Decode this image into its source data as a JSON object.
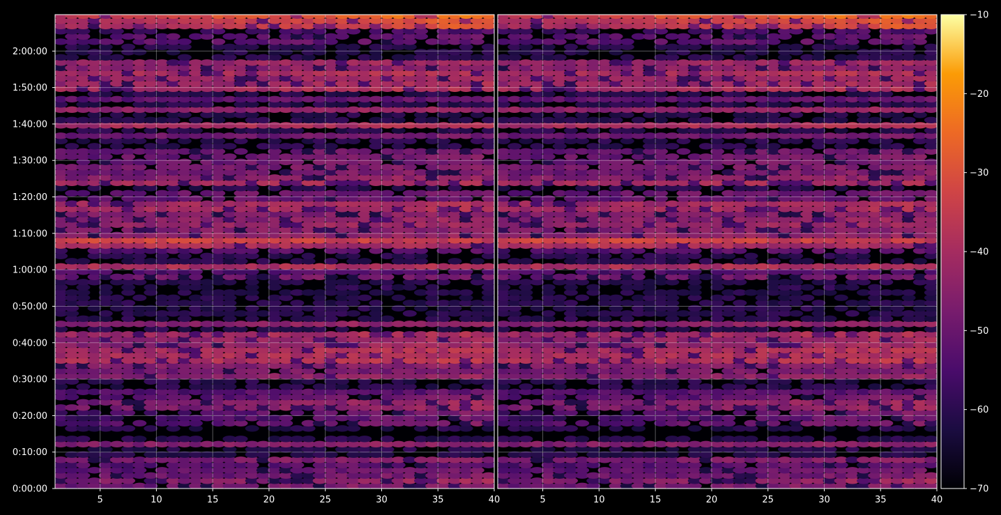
{
  "chart_data": {
    "type": "heatmap",
    "title": "",
    "xlabel": "",
    "ylabel": "",
    "grid": true,
    "panels": [
      {
        "x_ticks": [
          5,
          10,
          15,
          20,
          25,
          30,
          35,
          40
        ],
        "xlim": [
          1,
          40
        ],
        "y_ticks_seconds": [
          0,
          600,
          1200,
          1800,
          2400,
          3000,
          3600,
          4200,
          4800,
          5400,
          6000,
          6600,
          7200
        ],
        "y_tick_labels": [
          "0:00:00",
          "0:10:00",
          "0:20:00",
          "0:30:00",
          "0:40:00",
          "0:50:00",
          "1:00:00",
          "1:10:00",
          "1:20:00",
          "1:30:00",
          "1:40:00",
          "1:50:00",
          "2:00:00"
        ],
        "ylim_seconds": [
          0,
          7800
        ]
      },
      {
        "x_ticks": [
          5,
          10,
          15,
          20,
          25,
          30,
          35,
          40
        ],
        "xlim": [
          1,
          40
        ],
        "ylim_seconds": [
          0,
          7800
        ]
      }
    ],
    "bands": [
      {
        "t0": 0,
        "t1": 180,
        "level": -47,
        "trend": 7,
        "stripe": 0.85
      },
      {
        "t0": 180,
        "t1": 480,
        "level": -50,
        "trend": 4,
        "stripe": 0.9
      },
      {
        "t0": 480,
        "t1": 530,
        "level": -44,
        "trend": 2,
        "stripe": 1
      },
      {
        "t0": 710,
        "t1": 790,
        "level": -45,
        "trend": 3,
        "stripe": 1
      },
      {
        "t0": 880,
        "t1": 950,
        "level": -68,
        "trend": 0,
        "stripe": 0.3
      },
      {
        "t0": 1000,
        "t1": 1260,
        "level": -57,
        "trend": 9,
        "stripe": 0.7
      },
      {
        "t0": 1260,
        "t1": 1560,
        "level": -53,
        "trend": 8,
        "stripe": 0.8
      },
      {
        "t0": 1580,
        "t1": 1620,
        "level": -54,
        "trend": 4,
        "stripe": 1
      },
      {
        "t0": 1840,
        "t1": 2040,
        "level": -47,
        "trend": 3,
        "stripe": 0.9
      },
      {
        "t0": 2040,
        "t1": 2200,
        "level": -44,
        "trend": 4,
        "stripe": 0.9
      },
      {
        "t0": 2260,
        "t1": 2580,
        "level": -42,
        "trend": 5,
        "stripe": 0.85
      },
      {
        "t0": 2690,
        "t1": 2780,
        "level": -49,
        "trend": 4,
        "stripe": 1
      },
      {
        "t0": 3000,
        "t1": 3050,
        "level": -68,
        "trend": 0,
        "stripe": 0.3
      },
      {
        "t0": 3300,
        "t1": 3380,
        "level": -59,
        "trend": 0,
        "stripe": 0.7
      },
      {
        "t0": 3420,
        "t1": 3720,
        "level": -52,
        "trend": 2,
        "stripe": 0.8
      },
      {
        "t0": 3600,
        "t1": 3660,
        "level": -43,
        "trend": 0,
        "stripe": 1
      },
      {
        "t0": 3840,
        "t1": 3960,
        "level": -56,
        "trend": 4,
        "stripe": 0.7
      },
      {
        "t0": 3960,
        "t1": 4110,
        "level": -42,
        "trend": -2,
        "stripe": 0.9
      },
      {
        "t0": 4080,
        "t1": 4160,
        "level": -29,
        "trend": -3,
        "stripe": 1
      },
      {
        "t0": 4160,
        "t1": 4740,
        "level": -45,
        "trend": 4,
        "stripe": 0.85
      },
      {
        "t0": 4760,
        "t1": 4900,
        "level": -53,
        "trend": 5,
        "stripe": 0.8
      },
      {
        "t0": 5000,
        "t1": 5300,
        "level": -46,
        "trend": 4,
        "stripe": 0.85
      },
      {
        "t0": 5300,
        "t1": 5600,
        "level": -50,
        "trend": 4,
        "stripe": 0.8
      },
      {
        "t0": 5660,
        "t1": 5720,
        "level": -43,
        "trend": 0,
        "stripe": 1
      },
      {
        "t0": 5800,
        "t1": 5880,
        "level": -53,
        "trend": 3,
        "stripe": 1
      },
      {
        "t0": 5920,
        "t1": 6000,
        "level": -42,
        "trend": 4,
        "stripe": 1
      },
      {
        "t0": 6200,
        "t1": 6250,
        "level": -47,
        "trend": 2,
        "stripe": 1
      },
      {
        "t0": 6400,
        "t1": 6450,
        "level": -52,
        "trend": 2,
        "stripe": 1
      },
      {
        "t0": 6500,
        "t1": 7050,
        "level": -44,
        "trend": 3,
        "stripe": 0.85
      },
      {
        "t0": 6600,
        "t1": 6660,
        "level": -54,
        "trend": 2,
        "stripe": 1
      },
      {
        "t0": 7300,
        "t1": 7600,
        "level": -55,
        "trend": 3,
        "stripe": 0.7
      },
      {
        "t0": 7600,
        "t1": 7800,
        "level": -40,
        "trend": 14,
        "stripe": 0.9
      }
    ],
    "colorbar": {
      "colormap": "inferno",
      "vmin": -70,
      "vmax": -10,
      "ticks": [
        -70,
        -60,
        -50,
        -40,
        -30,
        -20,
        -10
      ],
      "tick_labels": [
        "−70",
        "−60",
        "−50",
        "−40",
        "−30",
        "−20",
        "−10"
      ]
    }
  }
}
